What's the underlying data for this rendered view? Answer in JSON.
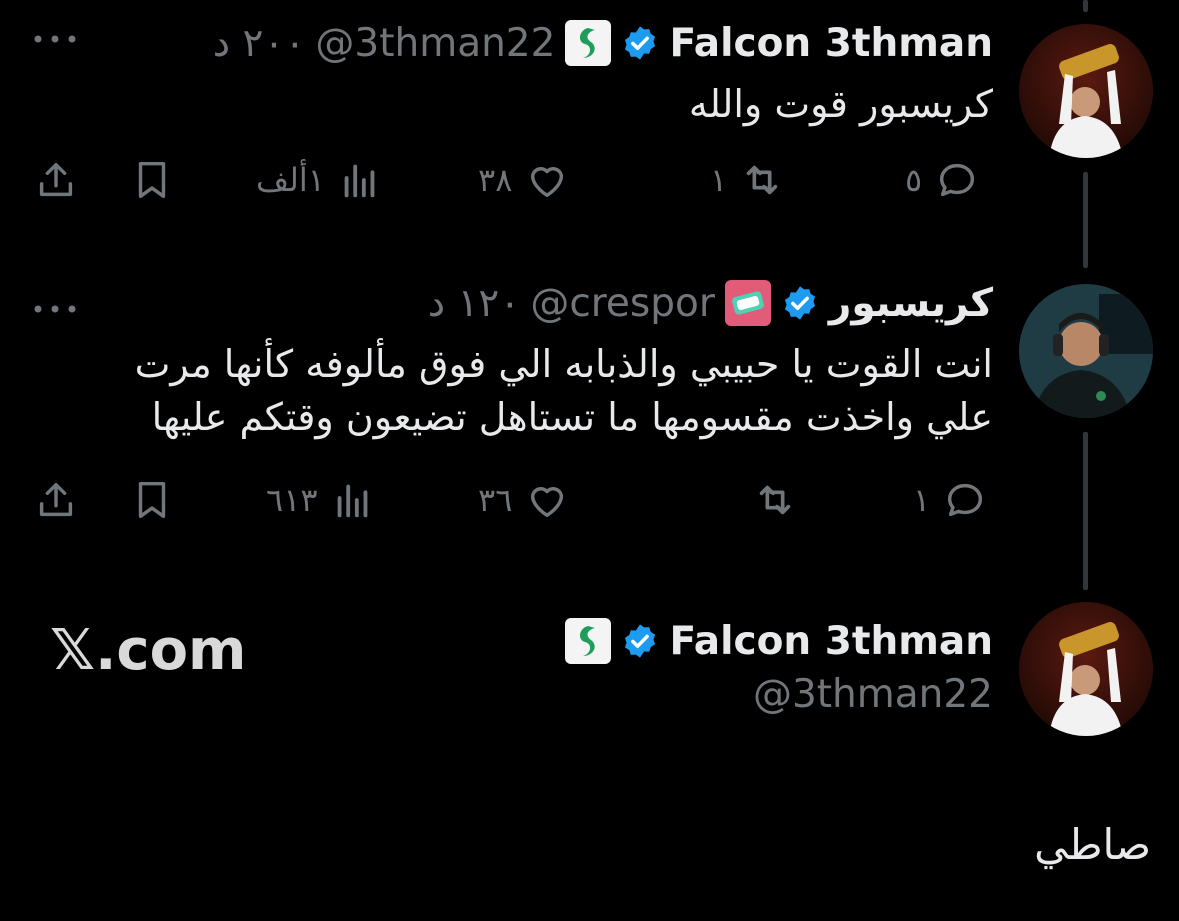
{
  "tweet1": {
    "name": "Falcon 3thman",
    "handle": "@3thman22",
    "time": "٢٠٠ د",
    "text": "كريسبور قوت والله",
    "replies": "٥",
    "retweets": "١",
    "likes": "٣٨",
    "views": "١ألف"
  },
  "tweet2": {
    "name": "كريسبور",
    "handle": "@crespor",
    "time": "١٢٠ د",
    "text_line1": "انت القوت يا حبيبي والذبابه الي فوق مألوفه كأنها مرت",
    "text_line2": "علي واخذت مقسومها ما تستاهل تضيعون وقتكم عليها",
    "replies": "١",
    "retweets": "",
    "likes": "٣٦",
    "views": "٦١٣"
  },
  "profile_card": {
    "name": "Falcon 3thman",
    "handle": "@3thman22",
    "site": "𝕏.com"
  },
  "bottom_text": "صاطي",
  "colors": {
    "background": "#000000",
    "text": "#e7e9ea",
    "muted": "#71767b",
    "verified": "#1d9bf0"
  },
  "icons": [
    "more-icon",
    "reply-icon",
    "retweet-icon",
    "like-icon",
    "views-icon",
    "bookmark-icon",
    "share-icon",
    "verified-icon"
  ]
}
